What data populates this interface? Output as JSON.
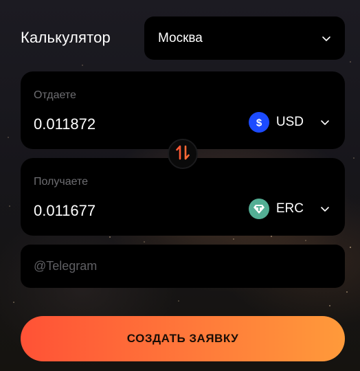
{
  "header": {
    "title": "Калькулятор"
  },
  "city": {
    "value": "Москва",
    "icon": "chevron-down-icon"
  },
  "give": {
    "label": "Отдаете",
    "amount": "0.011872",
    "currency": {
      "code": "USD",
      "icon": "dollar-coin-icon",
      "color": "#1c4bff"
    }
  },
  "swap": {
    "icon": "swap-arrows-icon",
    "color": "#ff5a36"
  },
  "get": {
    "label": "Получаете",
    "amount": "0.011677",
    "currency": {
      "code": "ERC",
      "icon": "tether-coin-icon",
      "color": "#53ae94"
    }
  },
  "telegram": {
    "placeholder": "@Telegram",
    "value": ""
  },
  "submit": {
    "label": "СОЗДАТЬ ЗАЯВКУ",
    "gradient": [
      "#ff5236",
      "#ff9a3a"
    ]
  }
}
